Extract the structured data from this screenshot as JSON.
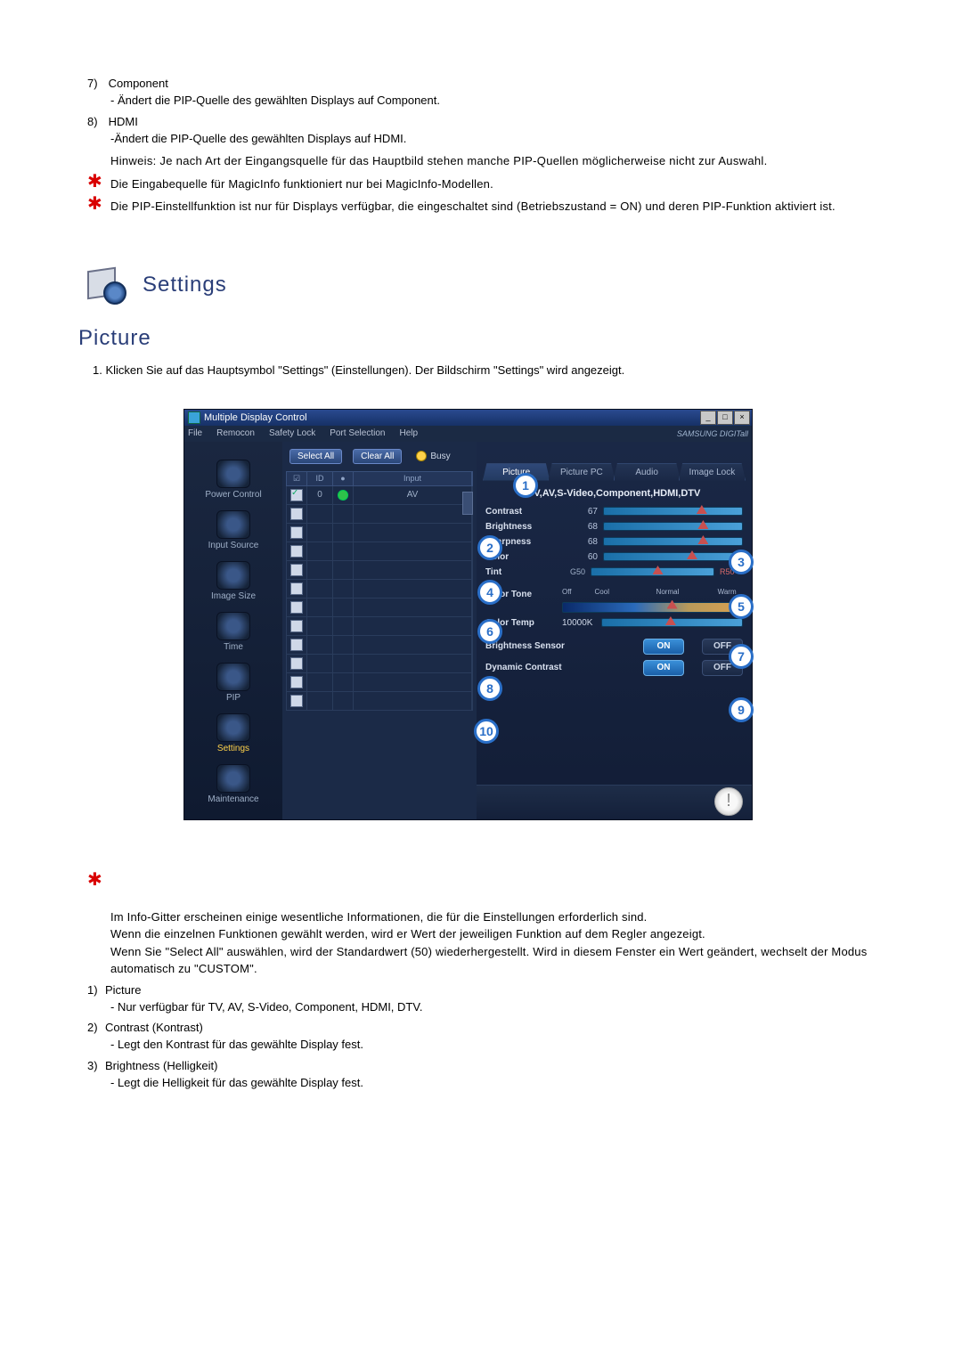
{
  "top_items": [
    {
      "num": "7)",
      "title": "Component",
      "lines": [
        "- Ändert die PIP-Quelle des gewählten Displays auf Component."
      ]
    },
    {
      "num": "8)",
      "title": "HDMI",
      "lines": [
        "-Ändert die PIP-Quelle des gewählten Displays auf HDMI.",
        "Hinweis: Je nach Art der Eingangsquelle für das Hauptbild stehen manche PIP-Quellen möglicherweise nicht zur Auswahl."
      ]
    }
  ],
  "top_stars": [
    "Die Eingabequelle für MagicInfo funktioniert nur bei MagicInfo-Modellen.",
    "Die PIP-Einstellfunktion ist nur für Displays verfügbar, die eingeschaltet sind (Betriebszustand = ON) und deren PIP-Funktion aktiviert ist."
  ],
  "settings_heading": "Settings",
  "picture_heading": "Picture",
  "intro": "1.  Klicken Sie auf das Hauptsymbol \"Settings\" (Einstellungen). Der Bildschirm \"Settings\" wird angezeigt.",
  "app": {
    "title": "Multiple Display Control",
    "menu": [
      "File",
      "Remocon",
      "Safety Lock",
      "Port Selection",
      "Help"
    ],
    "brand": "SAMSUNG DIGITall",
    "buttons": {
      "select_all": "Select All",
      "clear_all": "Clear All",
      "busy": "Busy"
    },
    "grid": {
      "headers": {
        "c1": "☑",
        "c2": "ID",
        "c3": "●",
        "c4": "Input"
      },
      "row0": {
        "id": "0",
        "input": "AV"
      },
      "blank_rows": 11
    },
    "sidebar": {
      "items": [
        {
          "label": "Power Control"
        },
        {
          "label": "Input Source"
        },
        {
          "label": "Image Size"
        },
        {
          "label": "Time"
        },
        {
          "label": "PIP"
        },
        {
          "label": "Settings",
          "active": true
        },
        {
          "label": "Maintenance"
        }
      ]
    },
    "tabs": [
      "Picture",
      "Picture PC",
      "Audio",
      "Image Lock"
    ],
    "panel_title": "TV,AV,S-Video,Component,HDMI,DTV",
    "sliders": {
      "contrast": {
        "label": "Contrast",
        "value": "67",
        "pct": 67
      },
      "brightness": {
        "label": "Brightness",
        "value": "68",
        "pct": 68
      },
      "sharpness": {
        "label": "Sharpness",
        "value": "68",
        "pct": 68
      },
      "color": {
        "label": "Color",
        "value": "60",
        "pct": 60
      },
      "tint": {
        "label": "Tint",
        "left": "G50",
        "right": "R50",
        "pct": 50
      }
    },
    "color_tone": {
      "label": "Color Tone",
      "marks": [
        "Off",
        "Cool",
        "Normal",
        "Warm"
      ],
      "pct": 58
    },
    "color_temp": {
      "label": "Color Temp",
      "value": "10000K",
      "pct": 45
    },
    "brightness_sensor": {
      "label": "Brightness Sensor",
      "on": "ON",
      "off": "OFF"
    },
    "dynamic_contrast": {
      "label": "Dynamic Contrast",
      "on": "ON",
      "off": "OFF"
    }
  },
  "callouts": [
    "1",
    "2",
    "3",
    "4",
    "5",
    "6",
    "7",
    "8",
    "9",
    "10"
  ],
  "bottom_star": "Im Info-Gitter erscheinen einige wesentliche Informationen, die für die Einstellungen erforderlich sind.\nWenn die einzelnen Funktionen gewählt werden, wird er Wert der jeweiligen Funktion auf dem Regler angezeigt.\nWenn Sie \"Select All\" auswählen, wird der Standardwert (50) wiederhergestellt. Wird in diesem Fenster ein Wert geändert, wechselt der Modus automatisch zu \"CUSTOM\".",
  "bottom_items": [
    {
      "num": "1)",
      "title": "Picture",
      "lines": [
        "- Nur verfügbar für TV, AV, S-Video, Component, HDMI, DTV."
      ]
    },
    {
      "num": "2)",
      "title": "Contrast (Kontrast)",
      "lines": [
        "- Legt den Kontrast für das gewählte Display fest."
      ]
    },
    {
      "num": "3)",
      "title": "Brightness (Helligkeit)",
      "lines": [
        "- Legt die Helligkeit für das gewählte Display fest."
      ]
    }
  ]
}
